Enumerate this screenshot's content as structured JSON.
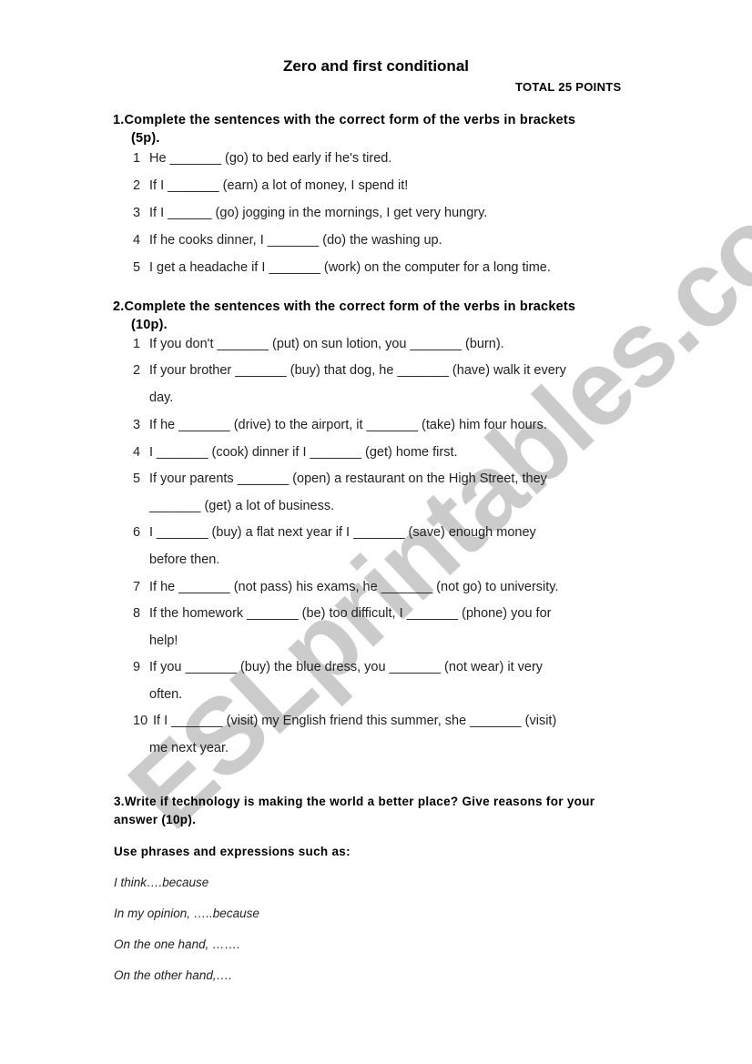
{
  "watermark": "ESLprintables.com",
  "title": "Zero and first conditional",
  "total": "TOTAL  25 POINTS",
  "section1": {
    "heading_line1": "1.Complete the sentences with the correct form of the verbs in brackets",
    "heading_line2": "(5p).",
    "items": [
      {
        "num": "1",
        "text": "He _______ (go) to bed early if he's tired."
      },
      {
        "num": "2",
        "text": "If I _______ (earn) a lot of money, I spend it!"
      },
      {
        "num": "3",
        "text": "If I ______ (go) jogging in the mornings, I get very hungry."
      },
      {
        "num": "4",
        "text": "If he cooks dinner, I _______ (do) the washing up."
      },
      {
        "num": "5",
        "text": "I get a headache if I _______ (work) on the computer for a long time."
      }
    ]
  },
  "section2": {
    "heading_line1": "2.Complete the sentences with the correct form of the verbs in brackets",
    "heading_line2": "(10p).",
    "items": [
      {
        "num": "1",
        "text": "If you don't _______ (put) on sun lotion, you _______ (burn).",
        "cont": ""
      },
      {
        "num": "2",
        "text": "If your brother _______ (buy) that dog, he _______ (have) walk it every",
        "cont": "day."
      },
      {
        "num": "3",
        "text": "If he _______ (drive) to the airport, it _______ (take) him four hours.",
        "cont": ""
      },
      {
        "num": "4",
        "text": "I _______ (cook) dinner if I _______ (get) home first.",
        "cont": ""
      },
      {
        "num": "5",
        "text": "If your parents _______ (open) a restaurant on the High Street, they",
        "cont": "_______ (get) a lot of business."
      },
      {
        "num": "6",
        "text": "I _______ (buy) a flat next year if I _______ (save) enough money",
        "cont": "before then."
      },
      {
        "num": "7",
        "text": "If he _______ (not pass) his exams, he _______ (not go) to university.",
        "cont": ""
      },
      {
        "num": "8",
        "text": "If the homework _______ (be) too difficult, I _______ (phone) you for",
        "cont": "help!"
      },
      {
        "num": "9",
        "text": "If you _______ (buy) the blue dress, you _______ (not wear) it very",
        "cont": "often."
      },
      {
        "num": "10",
        "text": " If I _______ (visit) my English friend this summer, she _______ (visit)",
        "cont": "me next year."
      }
    ]
  },
  "section3": {
    "heading_line1": "3.Write if technology is making the world a better place? Give reasons for your",
    "heading_line2": "answer (10p).",
    "instruction": "Use phrases and expressions such as:",
    "phrases": [
      "I think….because",
      "In my opinion, …..because",
      "On the one hand, …….",
      "On the other hand,…."
    ]
  }
}
